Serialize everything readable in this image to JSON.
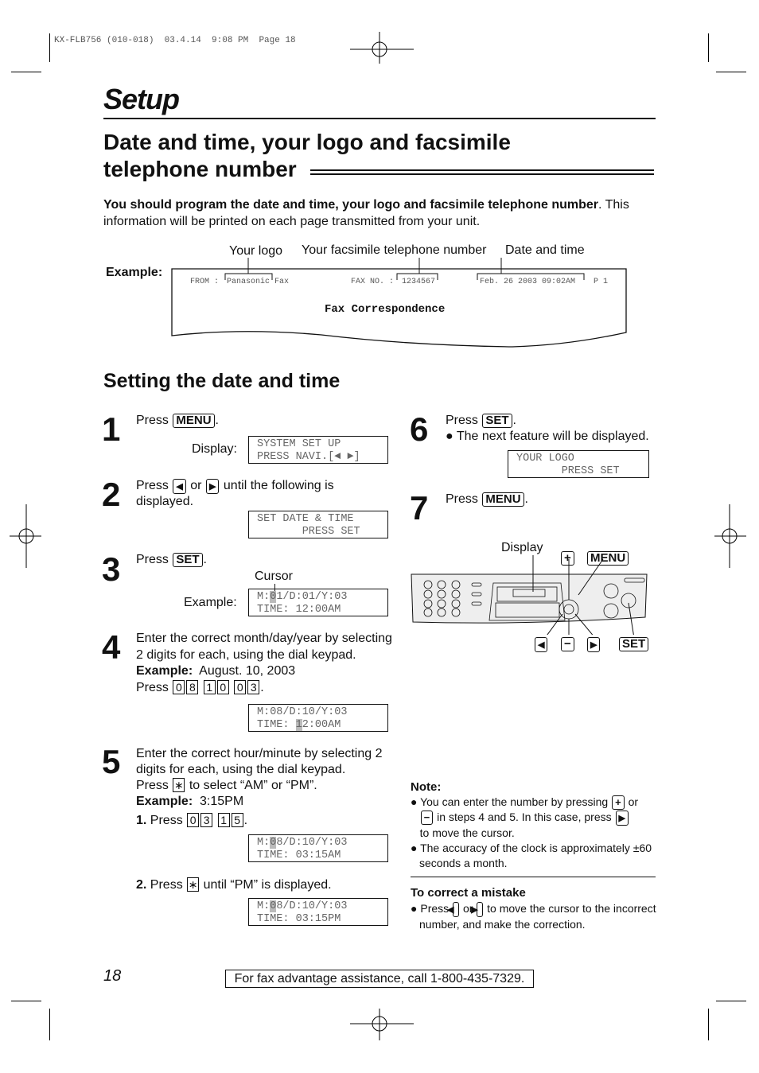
{
  "print_header": "KX-FLB756 (010-018)  03.4.14  9:08 PM  Page 18",
  "section": "Setup",
  "title_line1": "Date and time, your logo and facsimile",
  "title_line2": "telephone number",
  "intro_bold": "You should program the date and time, your logo and facsimile telephone number",
  "intro_rest": ". This information will be printed on each page transmitted from your unit.",
  "example": {
    "label": "Example:",
    "logo_label": "Your logo",
    "fax_label": "Your facsimile telephone number",
    "date_label": "Date and time",
    "from": "FROM :",
    "logo": "Panasonic Fax",
    "faxno": "FAX NO. :",
    "number": "1234567",
    "date": "Feb. 26 2003 09:02AM",
    "page": "P 1",
    "body": "Fax Correspondence"
  },
  "subtitle": "Setting the date and time",
  "keys": {
    "menu": "MENU",
    "set": "SET",
    "plus": "+",
    "minus": "−",
    "star": "∗"
  },
  "steps": {
    "s1": {
      "n": "1",
      "press": "Press",
      "display": "Display:",
      "lcd1": "SYSTEM SET UP",
      "lcd2": "PRESS NAVI.[◄ ►]"
    },
    "s2": {
      "n": "2",
      "press": "Press",
      "or": "or",
      "rest": "until the following is displayed.",
      "lcd1": "SET DATE & TIME",
      "lcd2": "       PRESS SET"
    },
    "s3": {
      "n": "3",
      "press": "Press",
      "cursor": "Cursor",
      "example": "Example:",
      "lcd1a": "M:",
      "lcd1c": "0",
      "lcd1b": "1/D:01/Y:03",
      "lcd2": "TIME: 12:00AM"
    },
    "s4": {
      "n": "4",
      "text": "Enter the correct month/day/year by selecting 2 digits for each, using the dial keypad.",
      "example_bold": "Example:",
      "example": "August. 10, 2003",
      "press": "Press",
      "digits": [
        [
          "0",
          "8"
        ],
        [
          "1",
          "0"
        ],
        [
          "0",
          "3"
        ]
      ],
      "lcd1": "M:08/D:10/Y:03",
      "lcd2a": "TIME: ",
      "lcd2c": "1",
      "lcd2b": "2:00AM"
    },
    "s5": {
      "n": "5",
      "text": "Enter the correct hour/minute by selecting 2 digits for each, using the dial keypad.",
      "press": "Press",
      "star_text": "to select “AM” or “PM”.",
      "example_bold": "Example:",
      "example": "3:15PM",
      "sub1": "1.",
      "sub1_press": "Press",
      "digits": [
        [
          "0",
          "3"
        ],
        [
          "1",
          "5"
        ]
      ],
      "lcd1a": "M:",
      "lcd1c": "0",
      "lcd1b": "8/D:10/Y:03",
      "lcd2": "TIME: 03:15AM",
      "sub2": "2.",
      "sub2_press": "Press",
      "sub2_rest": "until “PM” is displayed.",
      "lcd3a": "M:",
      "lcd3c": "0",
      "lcd3b": "8/D:10/Y:03",
      "lcd4": "TIME: 03:15PM"
    },
    "s6": {
      "n": "6",
      "press": "Press",
      "bullet": "The next feature will be displayed.",
      "lcd1": "YOUR LOGO",
      "lcd2": "       PRESS SET"
    },
    "s7": {
      "n": "7",
      "press": "Press"
    }
  },
  "diagram": {
    "display": "Display"
  },
  "note": {
    "title": "Note:",
    "b1a": "You can enter the number by pressing",
    "b1b": "or",
    "b1c": "in steps 4 and 5. In this case, press",
    "b1d": "to move the cursor.",
    "b2": "The accuracy of the clock is approximately ±60 seconds a month."
  },
  "mistake": {
    "title": "To correct a mistake",
    "press": "Press",
    "or": "or",
    "rest": "to move the cursor to the incorrect number, and make the correction."
  },
  "page_number": "18",
  "footer": "For fax advantage assistance, call 1-800-435-7329."
}
